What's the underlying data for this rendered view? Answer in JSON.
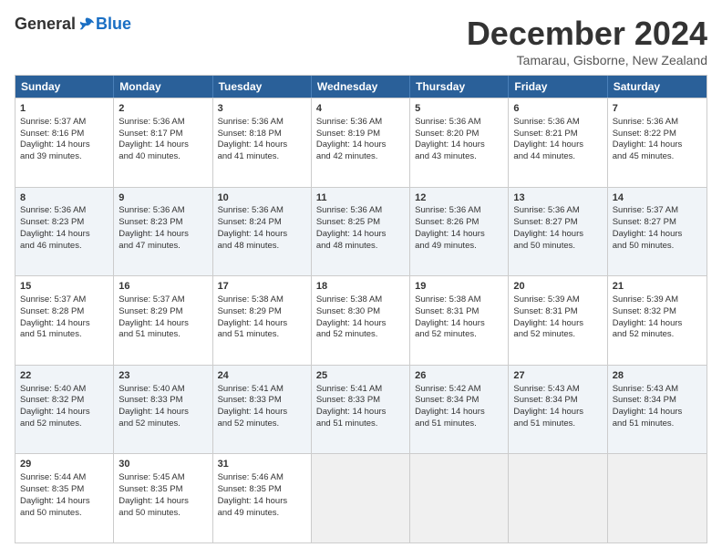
{
  "header": {
    "logo_general": "General",
    "logo_blue": "Blue",
    "month_title": "December 2024",
    "subtitle": "Tamarau, Gisborne, New Zealand"
  },
  "weekdays": [
    "Sunday",
    "Monday",
    "Tuesday",
    "Wednesday",
    "Thursday",
    "Friday",
    "Saturday"
  ],
  "rows": [
    [
      {
        "day": "1",
        "lines": [
          "Sunrise: 5:37 AM",
          "Sunset: 8:16 PM",
          "Daylight: 14 hours",
          "and 39 minutes."
        ]
      },
      {
        "day": "2",
        "lines": [
          "Sunrise: 5:36 AM",
          "Sunset: 8:17 PM",
          "Daylight: 14 hours",
          "and 40 minutes."
        ]
      },
      {
        "day": "3",
        "lines": [
          "Sunrise: 5:36 AM",
          "Sunset: 8:18 PM",
          "Daylight: 14 hours",
          "and 41 minutes."
        ]
      },
      {
        "day": "4",
        "lines": [
          "Sunrise: 5:36 AM",
          "Sunset: 8:19 PM",
          "Daylight: 14 hours",
          "and 42 minutes."
        ]
      },
      {
        "day": "5",
        "lines": [
          "Sunrise: 5:36 AM",
          "Sunset: 8:20 PM",
          "Daylight: 14 hours",
          "and 43 minutes."
        ]
      },
      {
        "day": "6",
        "lines": [
          "Sunrise: 5:36 AM",
          "Sunset: 8:21 PM",
          "Daylight: 14 hours",
          "and 44 minutes."
        ]
      },
      {
        "day": "7",
        "lines": [
          "Sunrise: 5:36 AM",
          "Sunset: 8:22 PM",
          "Daylight: 14 hours",
          "and 45 minutes."
        ]
      }
    ],
    [
      {
        "day": "8",
        "lines": [
          "Sunrise: 5:36 AM",
          "Sunset: 8:23 PM",
          "Daylight: 14 hours",
          "and 46 minutes."
        ]
      },
      {
        "day": "9",
        "lines": [
          "Sunrise: 5:36 AM",
          "Sunset: 8:23 PM",
          "Daylight: 14 hours",
          "and 47 minutes."
        ]
      },
      {
        "day": "10",
        "lines": [
          "Sunrise: 5:36 AM",
          "Sunset: 8:24 PM",
          "Daylight: 14 hours",
          "and 48 minutes."
        ]
      },
      {
        "day": "11",
        "lines": [
          "Sunrise: 5:36 AM",
          "Sunset: 8:25 PM",
          "Daylight: 14 hours",
          "and 48 minutes."
        ]
      },
      {
        "day": "12",
        "lines": [
          "Sunrise: 5:36 AM",
          "Sunset: 8:26 PM",
          "Daylight: 14 hours",
          "and 49 minutes."
        ]
      },
      {
        "day": "13",
        "lines": [
          "Sunrise: 5:36 AM",
          "Sunset: 8:27 PM",
          "Daylight: 14 hours",
          "and 50 minutes."
        ]
      },
      {
        "day": "14",
        "lines": [
          "Sunrise: 5:37 AM",
          "Sunset: 8:27 PM",
          "Daylight: 14 hours",
          "and 50 minutes."
        ]
      }
    ],
    [
      {
        "day": "15",
        "lines": [
          "Sunrise: 5:37 AM",
          "Sunset: 8:28 PM",
          "Daylight: 14 hours",
          "and 51 minutes."
        ]
      },
      {
        "day": "16",
        "lines": [
          "Sunrise: 5:37 AM",
          "Sunset: 8:29 PM",
          "Daylight: 14 hours",
          "and 51 minutes."
        ]
      },
      {
        "day": "17",
        "lines": [
          "Sunrise: 5:38 AM",
          "Sunset: 8:29 PM",
          "Daylight: 14 hours",
          "and 51 minutes."
        ]
      },
      {
        "day": "18",
        "lines": [
          "Sunrise: 5:38 AM",
          "Sunset: 8:30 PM",
          "Daylight: 14 hours",
          "and 52 minutes."
        ]
      },
      {
        "day": "19",
        "lines": [
          "Sunrise: 5:38 AM",
          "Sunset: 8:31 PM",
          "Daylight: 14 hours",
          "and 52 minutes."
        ]
      },
      {
        "day": "20",
        "lines": [
          "Sunrise: 5:39 AM",
          "Sunset: 8:31 PM",
          "Daylight: 14 hours",
          "and 52 minutes."
        ]
      },
      {
        "day": "21",
        "lines": [
          "Sunrise: 5:39 AM",
          "Sunset: 8:32 PM",
          "Daylight: 14 hours",
          "and 52 minutes."
        ]
      }
    ],
    [
      {
        "day": "22",
        "lines": [
          "Sunrise: 5:40 AM",
          "Sunset: 8:32 PM",
          "Daylight: 14 hours",
          "and 52 minutes."
        ]
      },
      {
        "day": "23",
        "lines": [
          "Sunrise: 5:40 AM",
          "Sunset: 8:33 PM",
          "Daylight: 14 hours",
          "and 52 minutes."
        ]
      },
      {
        "day": "24",
        "lines": [
          "Sunrise: 5:41 AM",
          "Sunset: 8:33 PM",
          "Daylight: 14 hours",
          "and 52 minutes."
        ]
      },
      {
        "day": "25",
        "lines": [
          "Sunrise: 5:41 AM",
          "Sunset: 8:33 PM",
          "Daylight: 14 hours",
          "and 51 minutes."
        ]
      },
      {
        "day": "26",
        "lines": [
          "Sunrise: 5:42 AM",
          "Sunset: 8:34 PM",
          "Daylight: 14 hours",
          "and 51 minutes."
        ]
      },
      {
        "day": "27",
        "lines": [
          "Sunrise: 5:43 AM",
          "Sunset: 8:34 PM",
          "Daylight: 14 hours",
          "and 51 minutes."
        ]
      },
      {
        "day": "28",
        "lines": [
          "Sunrise: 5:43 AM",
          "Sunset: 8:34 PM",
          "Daylight: 14 hours",
          "and 51 minutes."
        ]
      }
    ],
    [
      {
        "day": "29",
        "lines": [
          "Sunrise: 5:44 AM",
          "Sunset: 8:35 PM",
          "Daylight: 14 hours",
          "and 50 minutes."
        ]
      },
      {
        "day": "30",
        "lines": [
          "Sunrise: 5:45 AM",
          "Sunset: 8:35 PM",
          "Daylight: 14 hours",
          "and 50 minutes."
        ]
      },
      {
        "day": "31",
        "lines": [
          "Sunrise: 5:46 AM",
          "Sunset: 8:35 PM",
          "Daylight: 14 hours",
          "and 49 minutes."
        ]
      },
      {
        "day": "",
        "lines": []
      },
      {
        "day": "",
        "lines": []
      },
      {
        "day": "",
        "lines": []
      },
      {
        "day": "",
        "lines": []
      }
    ]
  ]
}
